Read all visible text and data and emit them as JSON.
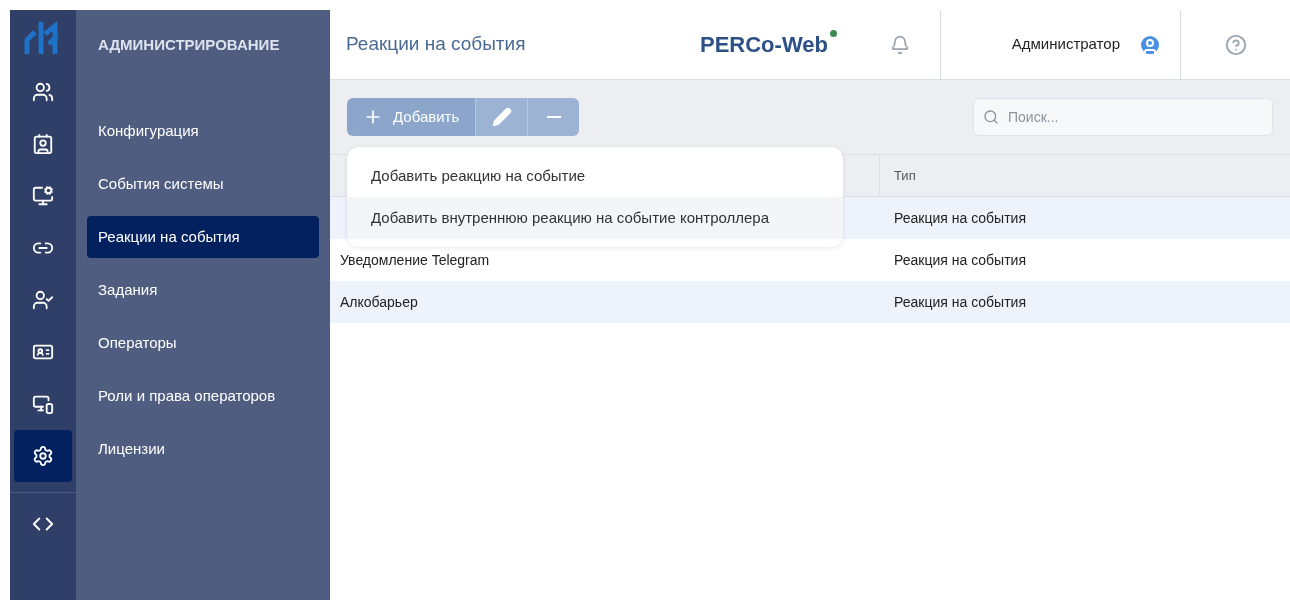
{
  "rail": {
    "items": [
      {
        "selected": false
      },
      {
        "selected": false
      },
      {
        "selected": false
      },
      {
        "selected": false
      },
      {
        "selected": false
      },
      {
        "selected": false
      },
      {
        "selected": false
      },
      {
        "selected": true
      }
    ]
  },
  "sidebar": {
    "title": "АДМИНИСТРИРОВАНИЕ",
    "items": [
      {
        "label": "Конфигурация",
        "selected": false
      },
      {
        "label": "События системы",
        "selected": false
      },
      {
        "label": "Реакции на события",
        "selected": true
      },
      {
        "label": "Задания",
        "selected": false
      },
      {
        "label": "Операторы",
        "selected": false
      },
      {
        "label": "Роли и права операторов",
        "selected": false
      },
      {
        "label": "Лицензии",
        "selected": false
      }
    ]
  },
  "header": {
    "title": "Реакции на события",
    "logo": "PERCo-Web",
    "user": "Администратор"
  },
  "toolbar": {
    "add_label": "Добавить",
    "search": {
      "placeholder": "Поиск..."
    }
  },
  "menu": {
    "items": [
      {
        "label": "Добавить реакцию на событие",
        "hovered": false
      },
      {
        "label": "Добавить внутреннюю реакцию на событие контроллера",
        "hovered": true
      }
    ]
  },
  "table": {
    "columns": [
      {
        "label": "Тип"
      }
    ],
    "rows": [
      {
        "type": "Реакция на события"
      },
      {
        "name": "Уведомление Telegram",
        "type": "Реакция на события"
      },
      {
        "name": "Алкобарьер",
        "type": "Реакция на события"
      }
    ]
  }
}
